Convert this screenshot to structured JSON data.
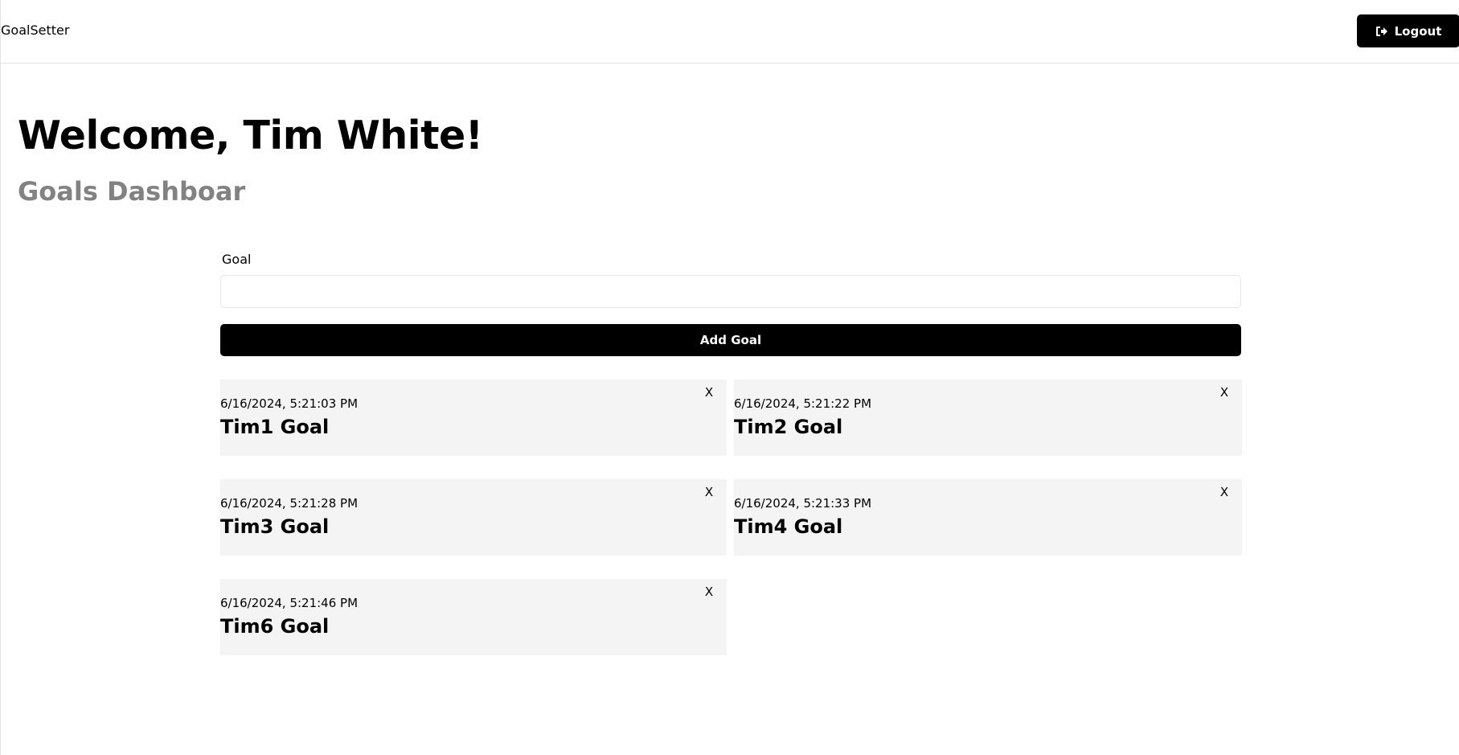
{
  "header": {
    "logo_text": "GoalSetter",
    "logout_label": "Logout",
    "logout_icon": "sign-out-icon"
  },
  "main": {
    "welcome_text": "Welcome, Tim White!",
    "subtitle": "Goals Dashboar"
  },
  "form": {
    "goal_label": "Goal",
    "goal_value": "",
    "goal_placeholder": "",
    "submit_label": "Add Goal"
  },
  "goals": [
    {
      "date": "6/16/2024, 5:21:03 PM",
      "title": "Tim1 Goal",
      "close_label": "X"
    },
    {
      "date": "6/16/2024, 5:21:22 PM",
      "title": "Tim2 Goal",
      "close_label": "X"
    },
    {
      "date": "6/16/2024, 5:21:28 PM",
      "title": "Tim3 Goal",
      "close_label": "X"
    },
    {
      "date": "6/16/2024, 5:21:33 PM",
      "title": "Tim4 Goal",
      "close_label": "X"
    },
    {
      "date": "6/16/2024, 5:21:46 PM",
      "title": "Tim6 Goal",
      "close_label": "X"
    }
  ],
  "colors": {
    "primary": "#000000",
    "subtitle": "#828282",
    "card_background": "#f4f4f4",
    "border": "#e2e2e2"
  }
}
